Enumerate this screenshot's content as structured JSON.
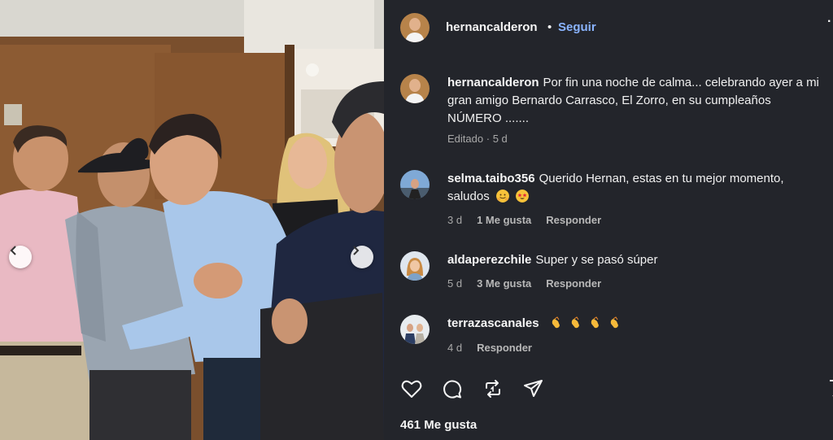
{
  "header": {
    "username": "hernancalderon",
    "separator": "•",
    "follow_label": "Seguir",
    "more_label": "·"
  },
  "caption": {
    "username": "hernancalderon",
    "text": "Por fin una noche de calma... celebrando ayer a mi gran amigo Bernardo Carrasco, El Zorro, en su cumpleaños NÚMERO .......",
    "edited_label": "Editado",
    "separator": "·",
    "time": "5 d"
  },
  "comments": [
    {
      "username": "selma.taibo356",
      "text": "Querido Hernan, estas en tu mejor momento, saludos",
      "emojis": [
        "hugging-face",
        "star-struck-face"
      ],
      "time": "3 d",
      "likes": "1 Me gusta",
      "reply_label": "Responder"
    },
    {
      "username": "aldaperezchile",
      "text": "Super y se pasó súper",
      "time": "5 d",
      "likes": "3 Me gusta",
      "reply_label": "Responder"
    },
    {
      "username": "terrazascanales",
      "text": "",
      "emojis": [
        "clapping-hands",
        "clapping-hands",
        "clapping-hands",
        "clapping-hands"
      ],
      "time": "4 d",
      "reply_label": "Responder"
    }
  ],
  "actions": {
    "icons": [
      "heart-icon",
      "comment-icon",
      "repost-icon",
      "share-icon",
      "bookmark-icon"
    ]
  },
  "likes_label": "461 Me gusta",
  "colors": {
    "panel_bg": "#23252b",
    "link_blue": "#8ab4ff",
    "muted_text": "#a8a8a8"
  }
}
